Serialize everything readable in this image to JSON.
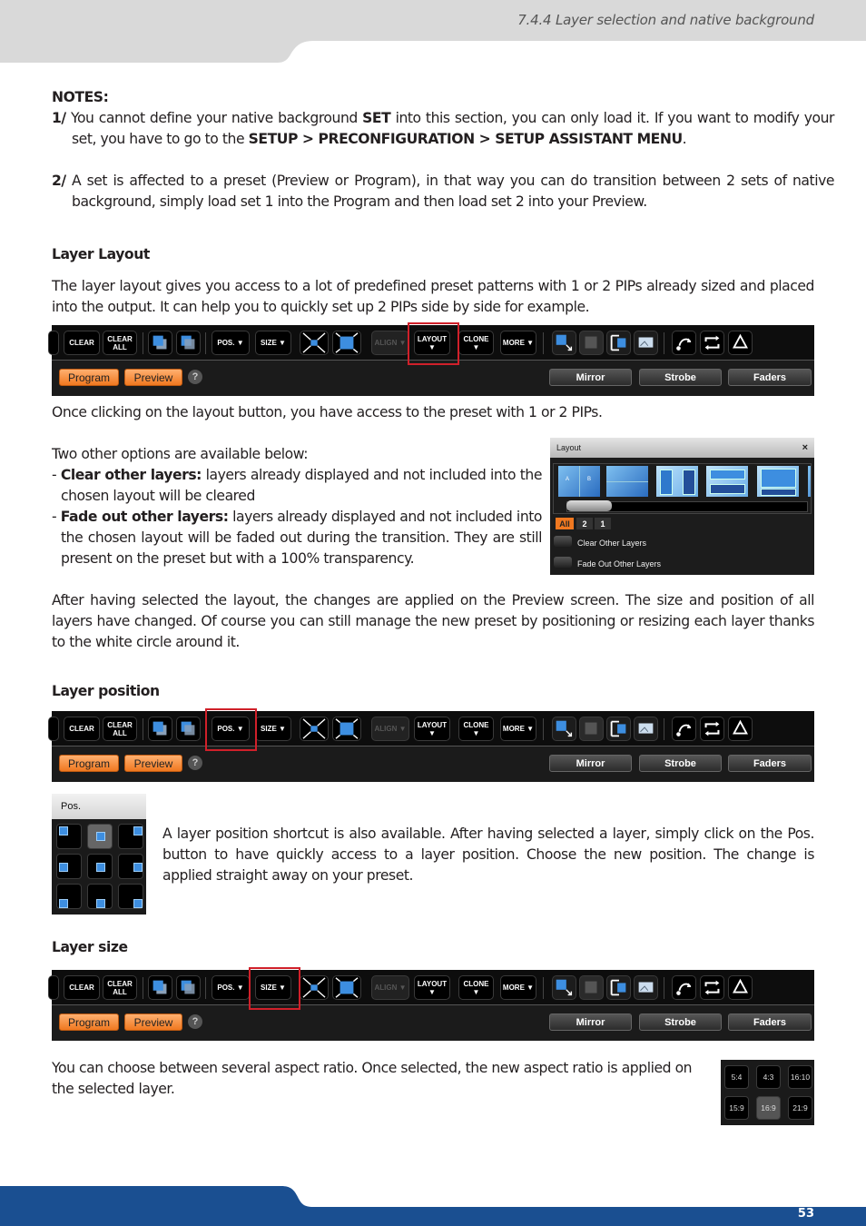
{
  "header": {
    "section_title": "7.4.4 Layer selection and native background"
  },
  "footer": {
    "page_number": "53"
  },
  "notes": {
    "title": "NOTES:",
    "n1_num": "1/",
    "n1_a": " You cannot define your native background ",
    "n1_b": "SET",
    "n1_c": " into this section, you can only load it. If you want to modify your set, you have to go to the ",
    "n1_d": "SETUP > PRECONFIGURATION > SETUP ASSISTANT MENU",
    "n1_e": ".",
    "n2_num": "2/",
    "n2_text": " A set is affected to a preset (Preview or Program), in that way you can do transition between 2 sets of native background, simply load set 1 into the Program and then load set 2 into your Preview."
  },
  "layer_layout": {
    "heading": "Layer Layout",
    "intro": "The layer layout gives you access to a lot of predefined preset patterns with 1 or 2 PIPs already sized and placed into the output. It can help you to quickly set up 2 PIPs side by side for example.",
    "after_toolbar": "Once clicking on the layout button, you have access to the preset with 1 or 2 PIPs.",
    "options_intro": "Two other options are available below:",
    "opt1_label": "Clear other layers:",
    "opt1_text": " layers already displayed and not included into the chosen layout will be cleared",
    "opt2_label": "Fade out other layers:",
    "opt2_text": " layers already displayed and not included into the chosen layout will be faded out during the transition. They are still present on the preset but with a 100% transparency.",
    "after_select": "After having selected the layout, the changes are applied on the Preview screen. The size and position of all layers have changed. Of course you can still manage the new preset by positioning or resizing each layer thanks to the white circle around it."
  },
  "layer_position": {
    "heading": "Layer position",
    "text": "A layer position shortcut is also available. After having selected a layer, simply click on the Pos. button to have quickly access to a layer position. Choose the new position. The change is applied straight away on your preset."
  },
  "layer_size": {
    "heading": "Layer size",
    "text": "You can choose between several aspect ratio. Once selected, the new aspect ratio is applied on the selected layer."
  },
  "toolbar": {
    "clear": "CLEAR",
    "clear_all": "CLEAR ALL",
    "pos": "POS. ▼",
    "size": "SIZE ▼",
    "align": "ALIGN ▼",
    "layout": "LAYOUT ▼",
    "clone": "CLONE ▼",
    "more": "MORE ▼",
    "program": "Program",
    "preview": "Preview",
    "help": "?",
    "mirror": "Mirror",
    "strobe": "Strobe",
    "faders": "Faders"
  },
  "layout_panel": {
    "title": "Layout",
    "close": "×",
    "tabs": [
      "All",
      "2",
      "1"
    ],
    "active_tab": "All",
    "clear_other": "Clear Other Layers",
    "fade_other": "Fade Out Other Layers",
    "thumb_a": "A",
    "thumb_b": "B"
  },
  "pos_panel": {
    "title": "Pos.",
    "selected": "top-center"
  },
  "ratio_panel": {
    "options": [
      "5:4",
      "4:3",
      "16:10",
      "15:9",
      "16:9",
      "21:9"
    ],
    "selected": "16:9"
  },
  "colors": {
    "accent_blue": "#1a4f91",
    "header_gray": "#d9d9d9",
    "highlight_red": "#d0202a",
    "orange": "#f07820"
  }
}
